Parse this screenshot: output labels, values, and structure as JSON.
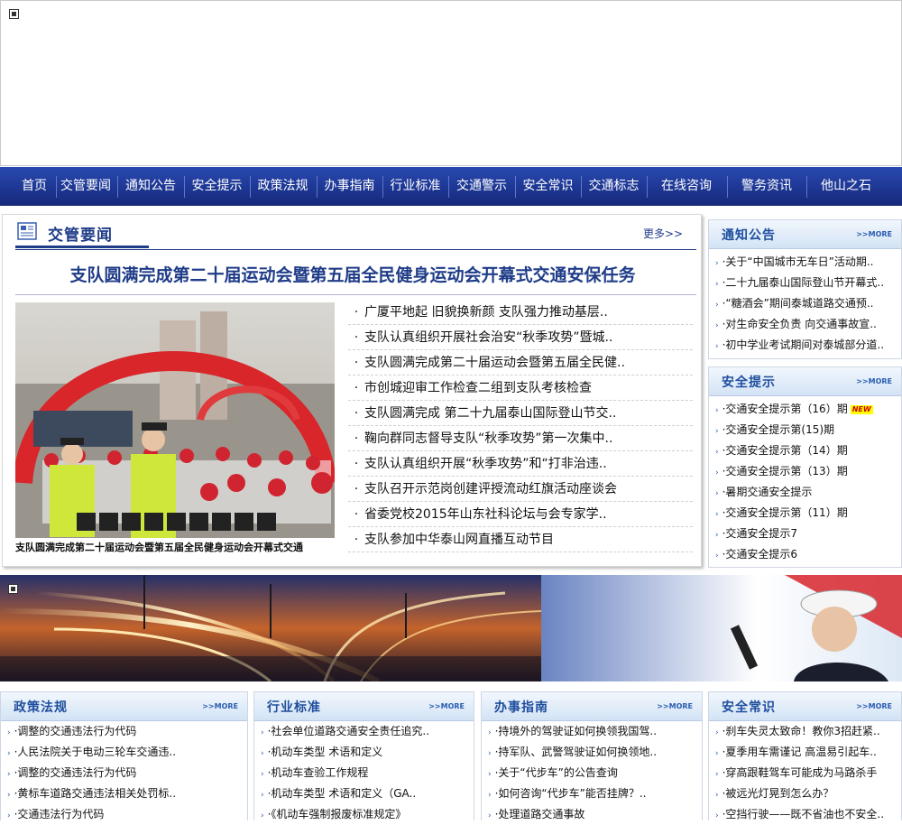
{
  "nav": [
    "首页",
    "交管要闻",
    "通知公告",
    "安全提示",
    "政策法规",
    "办事指南",
    "行业标准",
    "交通警示",
    "安全常识",
    "交通标志",
    "在线咨询",
    "警务资讯",
    "他山之石"
  ],
  "news": {
    "section_title": "交管要闻",
    "more": "更多>>",
    "headline": "支队圆满完成第二十届运动会暨第五届全民健身运动会开幕式交通安保任务",
    "photo_caption": "支队圆满完成第二十届运动会暨第五届全民健身运动会开幕式交通",
    "items": [
      "广厦平地起 旧貌换新颜 支队强力推动基层..",
      "支队认真组织开展社会治安“秋季攻势”暨城..",
      "支队圆满完成第二十届运动会暨第五届全民健..",
      "市创城迎审工作检查二组到支队考核检查",
      "支队圆满完成 第二十九届泰山国际登山节交..",
      "鞠向群同志督导支队“秋季攻势”第一次集中..",
      "支队认真组织开展“秋季攻势”和“打非治违..",
      "支队召开示范岗创建评授流动红旗活动座谈会",
      "省委党校2015年山东社科论坛与会专家学..",
      "支队参加中华泰山网直播互动节目"
    ]
  },
  "notice": {
    "title": "通知公告",
    "more": ">>MORE",
    "items": [
      "·关于“中国城市无车日”活动期..",
      "·二十九届泰山国际登山节开幕式..",
      "·“糖酒会”期间泰城道路交通预..",
      "·对生命安全负责 向交通事故宣..",
      "·初中学业考试期间对泰城部分道.."
    ]
  },
  "safety_tips": {
    "title": "安全提示",
    "more": ">>MORE",
    "new_badge": "NEW",
    "items": [
      "·交通安全提示第（16）期",
      "·交通安全提示第(15)期",
      "·交通安全提示第（14）期",
      "·交通安全提示第（13）期",
      "·暑期交通安全提示",
      "·交通安全提示第（11）期",
      "·交通安全提示7",
      "·交通安全提示6"
    ]
  },
  "bottom": [
    {
      "title": "政策法规",
      "more": ">>MORE",
      "items": [
        "·调整的交通违法行为代码",
        "·人民法院关于电动三轮车交通违..",
        "·调整的交通违法行为代码",
        "·黄标车道路交通违法相关处罚标..",
        "·交通违法行为代码"
      ]
    },
    {
      "title": "行业标准",
      "more": ">>MORE",
      "items": [
        "·社会单位道路交通安全责任追究..",
        "·机动车类型 术语和定义",
        "·机动车查验工作规程",
        "·机动车类型 术语和定义（GA..",
        "·《机动车强制报废标准规定》"
      ]
    },
    {
      "title": "办事指南",
      "more": ">>MORE",
      "items": [
        "·持境外的驾驶证如何换领我国驾..",
        "·持军队、武警驾驶证如何换领地..",
        "·关于“代步车”的公告查询",
        "·如何咨询“代步车”能否挂牌？..",
        "·处理道路交通事故"
      ]
    },
    {
      "title": "安全常识",
      "more": ">>MORE",
      "items": [
        "·刹车失灵太致命！教你3招赶紧..",
        "·夏季用车需谨记 高温易引起车..",
        "·穿高跟鞋驾车可能成为马路杀手",
        "·被远光灯晃到怎么办？",
        "·空挡行驶——既不省油也不安全.."
      ]
    }
  ],
  "colors": {
    "nav": "#1c3590",
    "accent": "#1f4e9e",
    "headline": "#1f3c88"
  }
}
